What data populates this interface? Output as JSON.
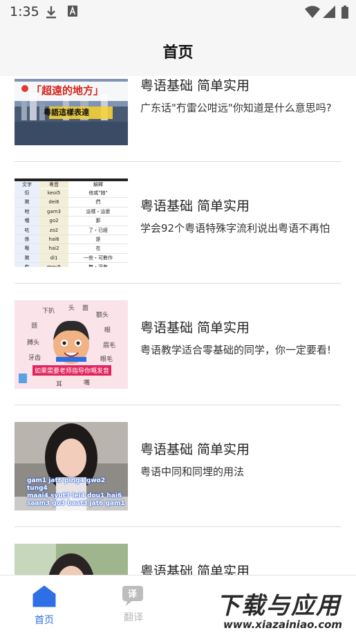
{
  "status_bar": {
    "time": "1:35"
  },
  "header": {
    "title": "首页"
  },
  "feed": [
    {
      "title": "粤语基础 简单实用",
      "desc": "广东话\"冇雷公咁远\"你知道是什么意思吗?",
      "thumb_text": [
        "「超遠的地方」",
        "粵語這樣表達"
      ]
    },
    {
      "title": "粤语基础 简单实用",
      "desc": "学会92个粤语特殊字流利说出粤语不再怕",
      "thumb_headers": [
        "文字",
        "粵音",
        "解釋"
      ],
      "thumb_rows": [
        [
          "佢",
          "keoi5",
          "他或\"她\""
        ],
        [
          "啲",
          "dei6",
          "們"
        ],
        [
          "咁",
          "gam3",
          "這樣・這麼"
        ],
        [
          "嗰",
          "go2",
          "那"
        ],
        [
          "咗",
          "zo2",
          "了・已經"
        ],
        [
          "係",
          "hai6",
          "是"
        ],
        [
          "喺",
          "hai2",
          "在"
        ],
        [
          "啲",
          "di1",
          "一些・可數作"
        ],
        [
          "冇",
          "mou5",
          "無・沒有"
        ]
      ]
    },
    {
      "title": "粤语基础 简单实用",
      "desc": "粤语教学适合零基础的同学，你一定要看!",
      "thumb_words": [
        "下扒",
        "头",
        "面",
        "额头",
        "颈",
        "眼",
        "膊头",
        "眉毛",
        "牙齿",
        "眼毛",
        "嘴",
        "耳"
      ],
      "thumb_badge": "如果需要老师指导你嘅发音"
    },
    {
      "title": "粤语基础 简单实用",
      "desc": "粤语中同和同埋的用法",
      "thumb_caption": [
        "gam1 jat6 ping4 gwo2 tung4",
        "maai4 syut3 lei4 dou1 hai6",
        "saam3 go3 baat3 jat6 gam1"
      ]
    },
    {
      "title": "粤语基础 简单实用",
      "desc": ""
    }
  ],
  "tabbar": {
    "home": "首页",
    "translate_icon": "译",
    "translate": "翻译"
  },
  "watermark": {
    "main": "下载与应用",
    "url": "www.xiazainiao.com"
  },
  "colors": {
    "accent": "#2f6fe6",
    "inactive": "#b8b8b8",
    "divider": "#dcdcdc",
    "header_bg": "#f6f6f6"
  }
}
